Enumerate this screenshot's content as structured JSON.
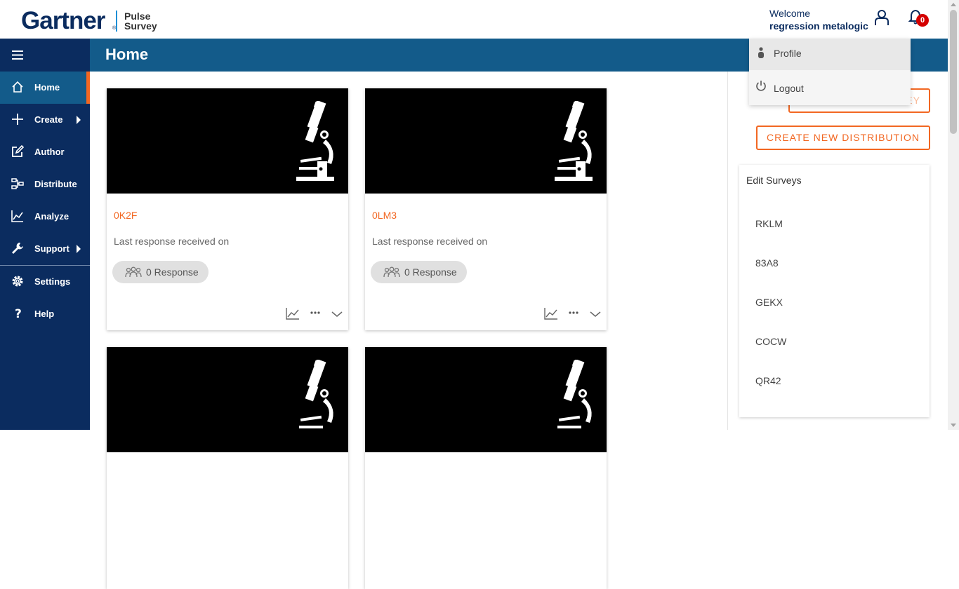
{
  "header": {
    "brand": "Gartner",
    "brand_mark": "®",
    "product_line1": "Pulse",
    "product_line2": "Survey",
    "welcome": "Welcome",
    "user_name": "regression metalogic",
    "notification_count": "0"
  },
  "page": {
    "title": "Home"
  },
  "sidebar": {
    "items": [
      {
        "label": "Home",
        "icon": "home-icon"
      },
      {
        "label": "Create",
        "icon": "plus-icon"
      },
      {
        "label": "Author",
        "icon": "edit-icon"
      },
      {
        "label": "Distribute",
        "icon": "distribute-icon"
      },
      {
        "label": "Analyze",
        "icon": "chart-icon"
      },
      {
        "label": "Support",
        "icon": "wrench-icon"
      },
      {
        "label": "Settings",
        "icon": "gear-icon"
      },
      {
        "label": "Help",
        "icon": "question-icon"
      }
    ]
  },
  "cards": [
    {
      "code": "0K2F",
      "last_response": "Last response received on",
      "responses": "0 Response"
    },
    {
      "code": "0LM3",
      "last_response": "Last response received on",
      "responses": "0 Response"
    }
  ],
  "right_panel": {
    "author_button": "AUTHOR NEW SURVEY",
    "distribution_button": "CREATE NEW DISTRIBUTION",
    "edit_title": "Edit Surveys",
    "surveys": [
      "RKLM",
      "83A8",
      "GEKX",
      "COCW",
      "QR42"
    ]
  },
  "user_menu": {
    "profile": "Profile",
    "logout": "Logout"
  },
  "colors": {
    "navy": "#0b2c5f",
    "banner": "#135b8a",
    "accent": "#f26722",
    "badge": "#d40000"
  }
}
